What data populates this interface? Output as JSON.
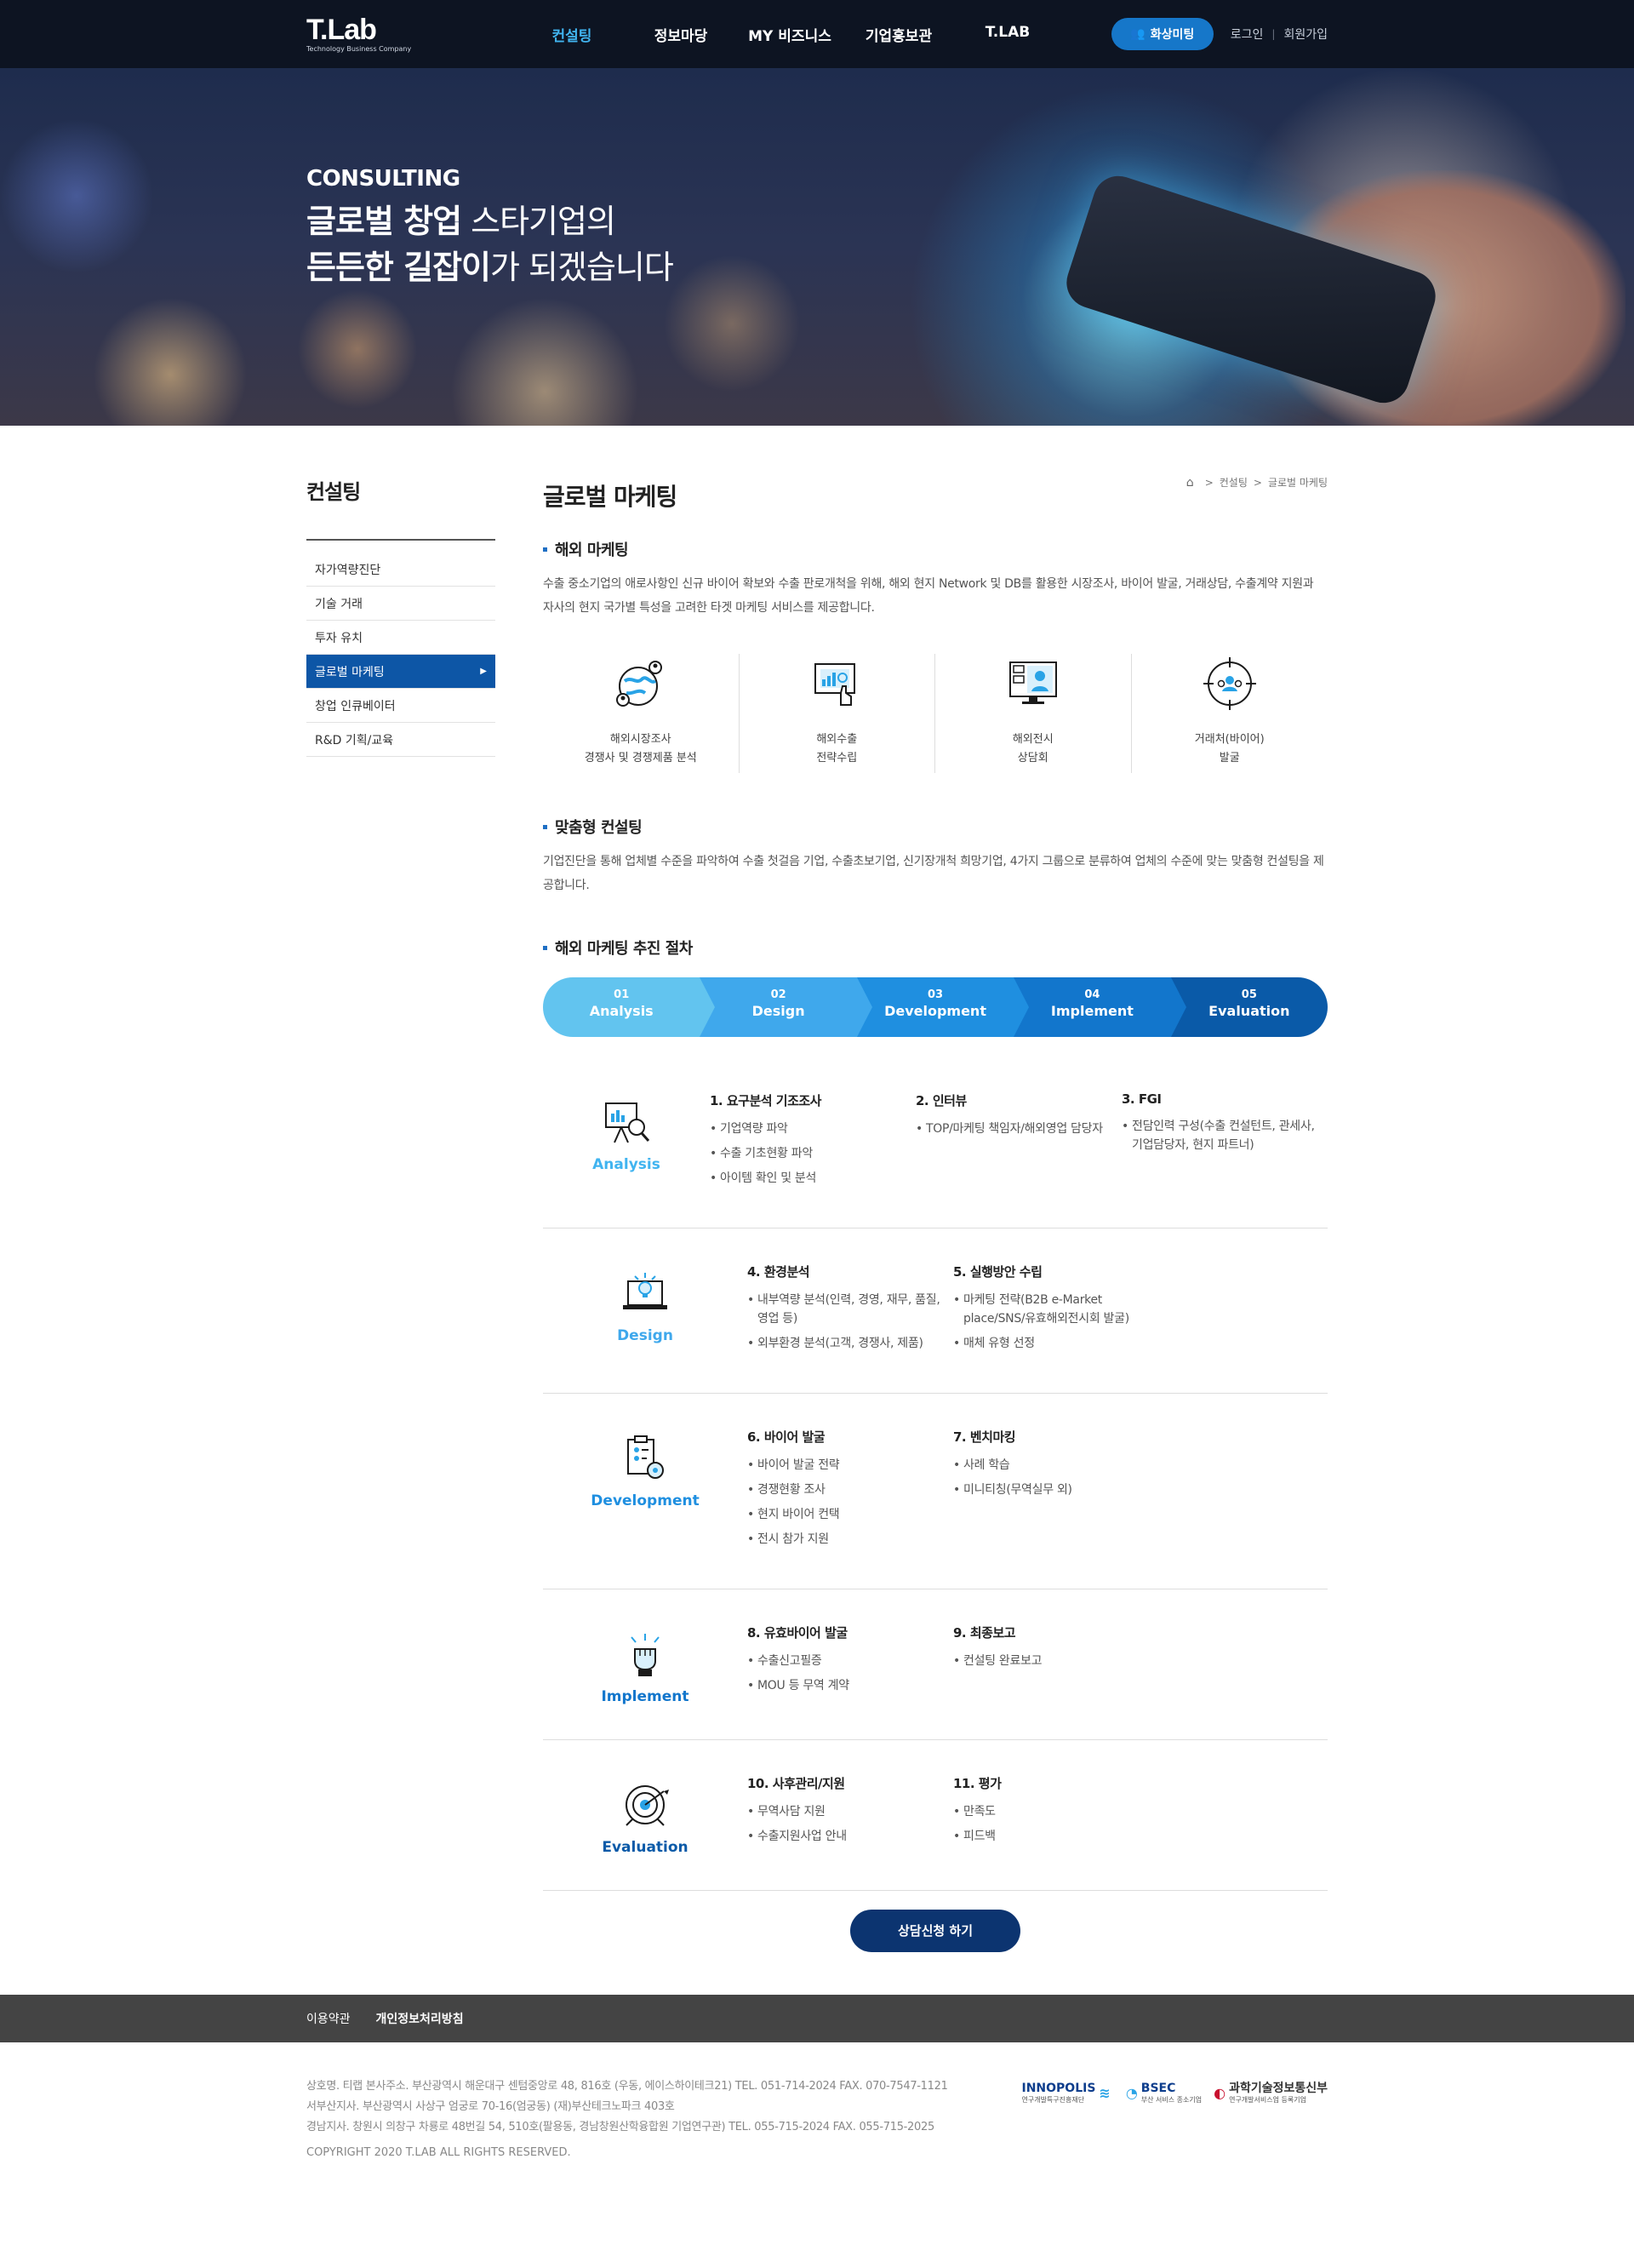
{
  "header": {
    "logo_title": "T.Lab",
    "logo_sub": "Technology Business Company",
    "nav": [
      "컨설팅",
      "정보마당",
      "MY 비즈니스",
      "기업홍보관",
      "T.LAB"
    ],
    "meeting_btn": "화상미팅",
    "login": "로그인",
    "join": "회원가입",
    "active_color": "#41b4f0"
  },
  "hero": {
    "eyebrow": "CONSULTING",
    "line1_bold": "글로벌 창업",
    "line1_rest": " 스타기업의",
    "line2_bold": "든든한 길잡이",
    "line2_rest": "가 되겠습니다"
  },
  "sidebar": {
    "title": "컨설팅",
    "items": [
      "자가역량진단",
      "기술 거래",
      "투자 유치",
      "글로벌 마케팅",
      "창업 인큐베이터",
      "R&D 기획/교육"
    ],
    "active_index": 3
  },
  "breadcrumb": [
    "컨설팅",
    "글로벌 마케팅"
  ],
  "page_title": "글로벌 마케팅",
  "overseas": {
    "title": "해외 마케팅",
    "desc": "수출 중소기업의 애로사항인 신규 바이어 확보와 수출 판로개척을 위해, 해외 현지 Network 및 DB를 활용한 시장조사, 바이어 발굴, 거래상담, 수출계약 지원과 자사의 현지 국가별 특성을 고려한 타겟 마케팅 서비스를 제공합니다.",
    "items": [
      {
        "label": "해외시장조사\n경쟁사 및 경쟁제품 분석",
        "icon": "globe-people-icon"
      },
      {
        "label": "해외수출\n전략수립",
        "icon": "chart-hand-icon"
      },
      {
        "label": "해외전시\n상담회",
        "icon": "display-users-icon"
      },
      {
        "label": "거래처(바이어)\n발굴",
        "icon": "target-people-icon"
      }
    ]
  },
  "custom": {
    "title": "맞춤형 컨설팅",
    "desc": "기업진단을 통해 업체별 수준을 파악하여 수출 첫걸음 기업, 수출초보기업, 신기장개척 희망기업, 4가지 그룹으로 분류하여 업체의 수준에 맞는 맞춤형 컨설팅을 제공합니다."
  },
  "process": {
    "title": "해외 마케팅 추진 절차",
    "steps": [
      {
        "num": "01",
        "label": "Analysis"
      },
      {
        "num": "02",
        "label": "Design"
      },
      {
        "num": "03",
        "label": "Development"
      },
      {
        "num": "04",
        "label": "Implement"
      },
      {
        "num": "05",
        "label": "Evaluation"
      }
    ],
    "colors": [
      "#62c4ef",
      "#3fa8ec",
      "#1f8fe0",
      "#1276cc",
      "#0a5aa8"
    ],
    "rows": [
      {
        "name": "Analysis",
        "color": "#41b4f0",
        "icon": "presentation-search-icon",
        "cols": [
          {
            "title": "1. 요구분석 기조조사",
            "items": [
              "기업역량 파악",
              "수출 기초현황 파악",
              "아이템 확인 및 분석"
            ]
          },
          {
            "title": "2. 인터뷰",
            "items": [
              "TOP/마케팅 책임자/해외영업 담당자"
            ]
          },
          {
            "title": "3. FGI",
            "items": [
              "전담인력 구성(수출 컨설턴트, 관세사, 기업담당자, 현지 파트너)"
            ]
          }
        ]
      },
      {
        "name": "Design",
        "color": "#3fa8ec",
        "icon": "laptop-idea-icon",
        "cols": [
          {
            "title": "4. 환경분석",
            "items": [
              "내부역량 분석(인력, 경영, 재무, 품질, 영업 등)",
              "외부환경 분석(고객, 경쟁사, 제품)"
            ]
          },
          {
            "title": "5. 실행방안 수립",
            "items": [
              "마케팅 전략(B2B e-Market place/SNS/유효해외전시회 발굴)",
              "매체 유형 선정"
            ]
          }
        ]
      },
      {
        "name": "Development",
        "color": "#1f8fe0",
        "icon": "clipboard-gear-icon",
        "cols": [
          {
            "title": "6. 바이어 발굴",
            "items": [
              "바이어 발굴 전략",
              "경쟁현황 조사",
              "현지 바이어 컨택",
              "전시 참가 지원"
            ]
          },
          {
            "title": "7. 벤치마킹",
            "items": [
              "사례 학습",
              "미니티칭(무역실무 외)"
            ]
          }
        ]
      },
      {
        "name": "Implement",
        "color": "#1276cc",
        "icon": "raised-fist-icon",
        "cols": [
          {
            "title": "8. 유효바이어 발굴",
            "items": [
              "수출신고필증",
              "MOU 등 무역 계약"
            ]
          },
          {
            "title": "9. 최종보고",
            "items": [
              "컨설팅 완료보고"
            ]
          }
        ]
      },
      {
        "name": "Evaluation",
        "color": "#0a5aa8",
        "icon": "target-arrow-icon",
        "cols": [
          {
            "title": "10. 사후관리/지원",
            "items": [
              "무역사담 지원",
              "수출지원사업 안내"
            ]
          },
          {
            "title": "11. 평가",
            "items": [
              "만족도",
              "피드백"
            ]
          }
        ]
      }
    ]
  },
  "cta": "상담신청 하기",
  "footer": {
    "links": [
      "이용약관",
      "개인정보처리방침"
    ],
    "address": [
      "상호명. 티랩   본사주소. 부산광역시 해운대구 센텀중앙로 48, 816호 (우동, 에이스하이테크21)   TEL. 051-714-2024   FAX. 070-7547-1121",
      "서부산지사. 부산광역시 사상구 엄궁로 70-16(엄궁동) (재)부산테크노파크 403호",
      "경남지사. 창원시 의창구 차룡로 48번길 54, 510호(팔용동, 경남창원산학융합원 기업연구관)   TEL. 055-715-2024   FAX. 055-715-2025"
    ],
    "copyright": "COPYRIGHT 2020 T.LAB ALL RIGHTS RESERVED.",
    "partners": [
      {
        "name": "INNOPOLIS",
        "sub": "연구개발특구진흥재단"
      },
      {
        "name": "BSEC",
        "sub": "부산 서비스 종소기업"
      },
      {
        "name": "과학기술정보통신부",
        "sub": "연구개발서비스업 등록기업"
      }
    ]
  }
}
